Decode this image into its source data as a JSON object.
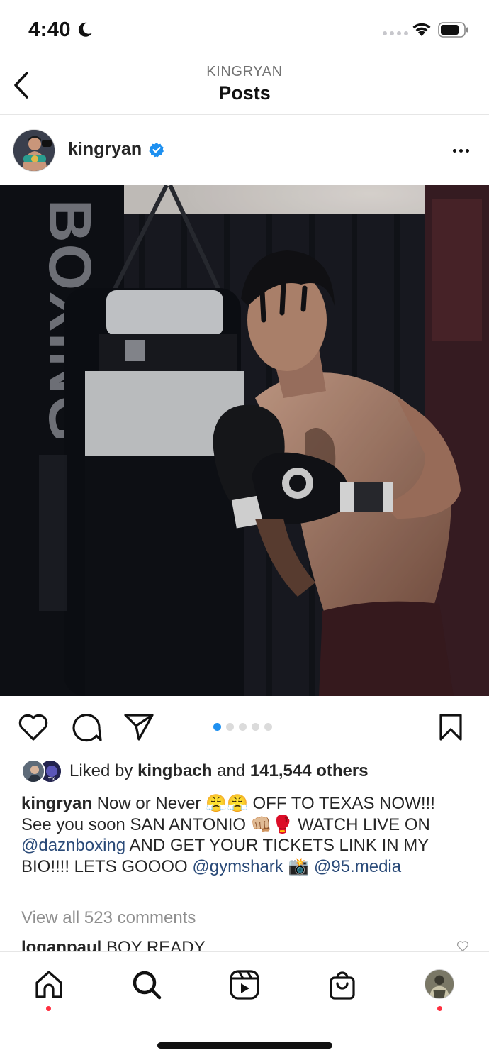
{
  "status_bar": {
    "time": "4:40"
  },
  "nav": {
    "subtitle": "KINGRYAN",
    "title": "Posts"
  },
  "post": {
    "username": "kingryan",
    "image_alt": "Boxer in black gloves beside a punching bag in a boxing gym",
    "bag_text": "BOXING",
    "carousel": {
      "count": 5,
      "active_index": 0
    }
  },
  "likes": {
    "prefix": "Liked by ",
    "user": "kingbach",
    "mid": " and ",
    "others": "141,544 others"
  },
  "caption": {
    "username": "kingryan",
    "text_1": " Now or Never 😤😤 OFF TO TEXAS NOW!!! See you soon SAN ANTONIO 👊🏼🥊 WATCH LIVE ON ",
    "mention_1": "@daznboxing",
    "text_2": " AND GET YOUR TICKETS LINK IN MY BIO!!!! LETS GOOOO ",
    "mention_2": "@gymshark",
    "text_3": " 📸 ",
    "mention_3": "@95.media"
  },
  "comments": {
    "view_all": "View all 523 comments",
    "first_user": "loganpaul",
    "first_text": " BOY READY"
  },
  "tabs": [
    "home",
    "search",
    "reels",
    "shop",
    "profile"
  ],
  "colors": {
    "accent_blue": "#1e90f0",
    "notification_red": "#ff3040",
    "mention_blue": "#2a4a78"
  }
}
